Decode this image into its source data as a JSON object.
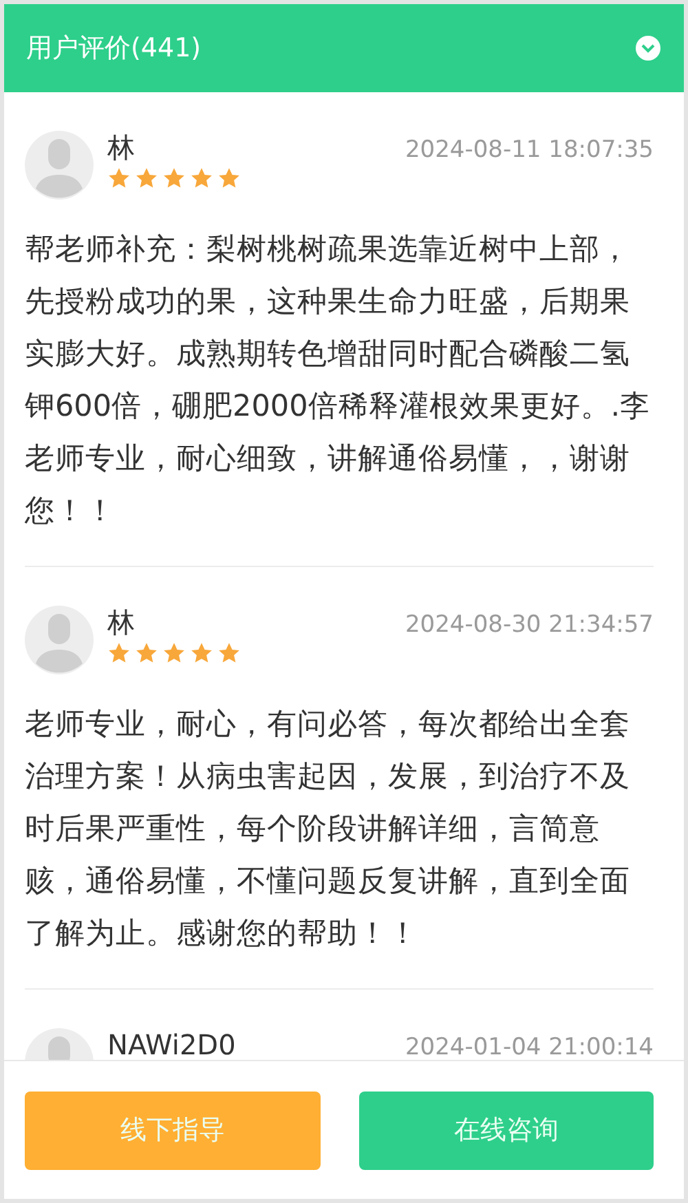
{
  "header": {
    "title": "用户评价(441)",
    "expanded": true
  },
  "reviews": [
    {
      "name": "林",
      "stars": 5,
      "time": "2024-08-11 18:07:35",
      "text": "帮老师补充：梨树桃树疏果选靠近树中上部，先授粉成功的果，这种果生命力旺盛，后期果实膨大好。成熟期转色增甜同时配合磷酸二氢钾600倍，硼肥2000倍稀释灌根效果更好。.李老师专业，耐心细致，讲解通俗易懂，，谢谢您！！"
    },
    {
      "name": "林",
      "stars": 5,
      "time": "2024-08-30 21:34:57",
      "text": "老师专业，耐心，有问必答，每次都给出全套治理方案！从病虫害起因，发展，到治疗不及时后果严重性，每个阶段讲解详细，言简意赅，通俗易懂，不懂问题反复讲解，直到全面了解为止。感谢您的帮助！！"
    },
    {
      "name": "NAWi2D0",
      "time": "2024-01-04 21:00:14"
    }
  ],
  "buttons": [
    {
      "label": "线下指导",
      "kind": "offline"
    },
    {
      "label": "在线咨询",
      "kind": "online"
    }
  ]
}
